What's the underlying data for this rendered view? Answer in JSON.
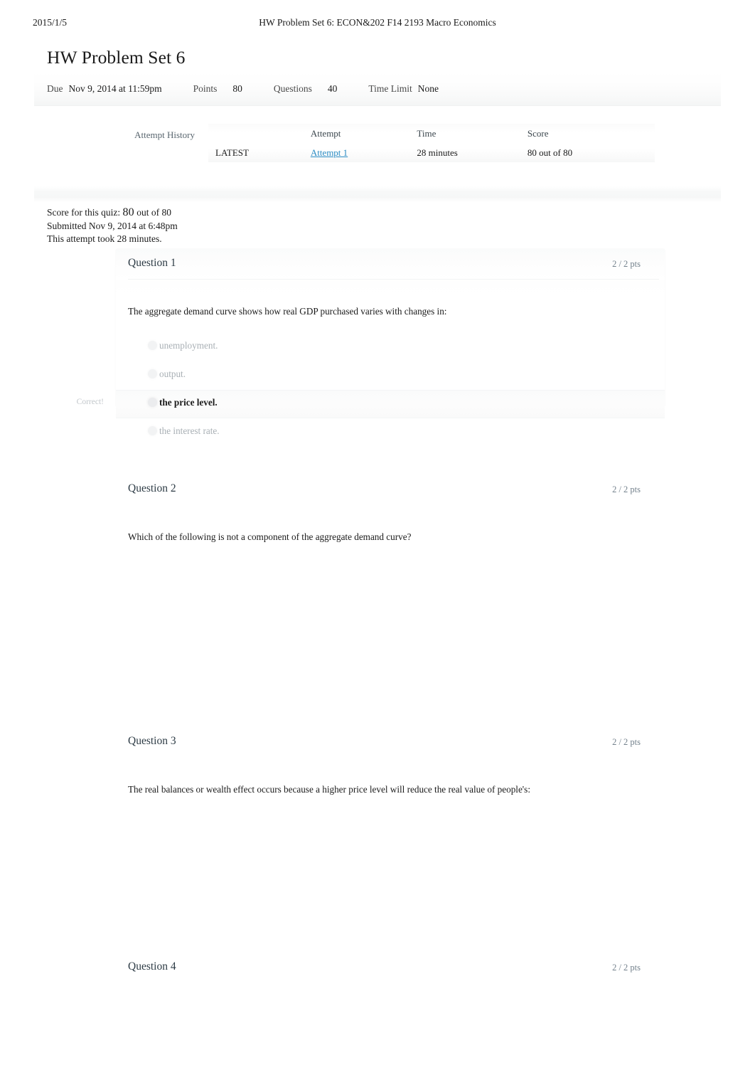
{
  "print_header": {
    "date": "2015/1/5",
    "title": "HW Problem Set 6: ECON&202 F14 2193  Macro Economics"
  },
  "page_title": "HW Problem Set 6",
  "quiz_meta": {
    "due_label": "Due",
    "due_value": "Nov 9, 2014 at 11:59pm",
    "points_label": "Points",
    "points_value": "80",
    "questions_label": "Questions",
    "questions_value": "40",
    "time_limit_label": "Time Limit",
    "time_limit_value": "None"
  },
  "attempt_history": {
    "label": "Attempt History",
    "columns": [
      "",
      "Attempt",
      "Time",
      "Score"
    ],
    "rows": [
      {
        "badge": "LATEST",
        "attempt": "Attempt 1",
        "time": "28 minutes",
        "score": "80 out of 80"
      }
    ],
    "link_color": "#2b8cc4"
  },
  "score_summary": {
    "score_label": "Score for this quiz:",
    "score_value": "80",
    "score_out_of": "out of 80",
    "submitted": "Submitted Nov 9, 2014 at 6:48pm",
    "duration": "This attempt took 28 minutes."
  },
  "questions": [
    {
      "name": "Question 1",
      "points": "2 / 2 pts",
      "text": "The aggregate demand curve shows how real GDP purchased varies with changes in:",
      "answers": [
        {
          "label": "unemployment.",
          "selected": false,
          "status": ""
        },
        {
          "label": "output.",
          "selected": false,
          "status": ""
        },
        {
          "label": "the price level.",
          "selected": true,
          "status": "Correct!"
        },
        {
          "label": "the interest rate.",
          "selected": false,
          "status": ""
        }
      ]
    },
    {
      "name": "Question 2",
      "points": "2 / 2 pts",
      "text": "Which of the following is not a component of the aggregate demand curve?",
      "answers": []
    },
    {
      "name": "Question 3",
      "points": "2 / 2 pts",
      "text": "The real balances or wealth effect occurs because a higher price level will reduce the real value of people's:",
      "answers": []
    },
    {
      "name": "Question 4",
      "points": "2 / 2 pts",
      "text": "",
      "answers": []
    }
  ]
}
